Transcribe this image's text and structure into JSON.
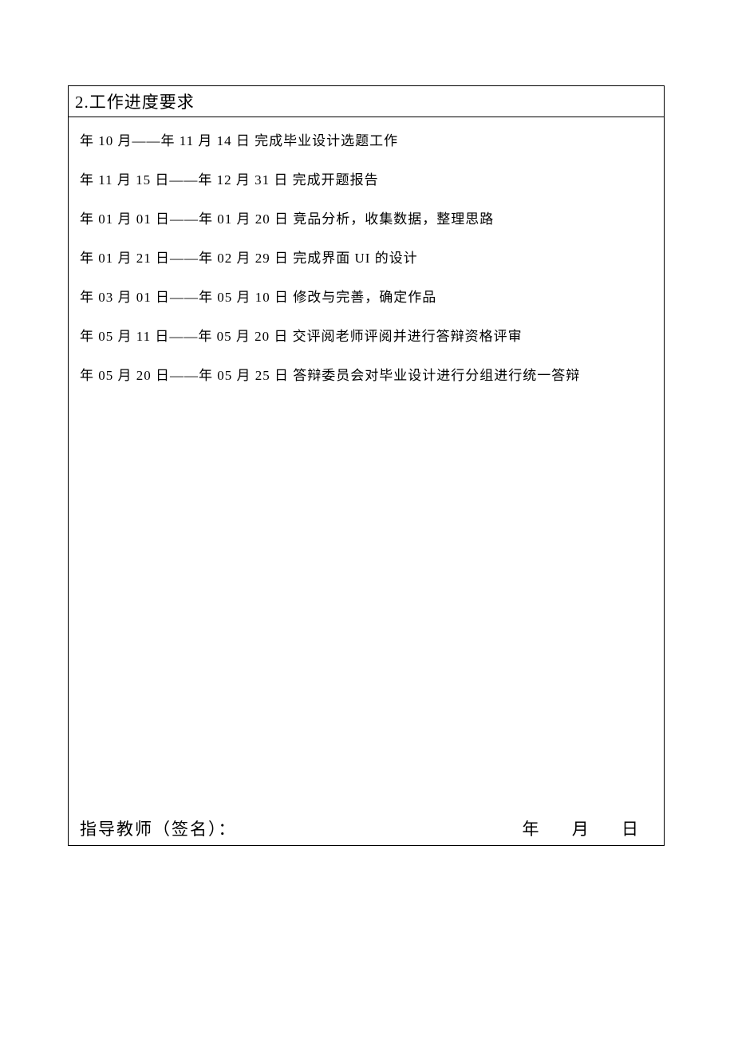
{
  "section": {
    "heading": "2.工作进度要求"
  },
  "schedule": [
    "年 10 月——年 11 月 14 日   完成毕业设计选题工作",
    "年 11 月 15 日——年 12 月 31 日  完成开题报告",
    "年 01 月 01 日——年 01 月 20 日  竞品分析，收集数据，整理思路",
    "年 01 月 21 日——年 02 月 29 日  完成界面 UI 的设计",
    "年 03 月 01 日——年 05 月 10 日  修改与完善，确定作品",
    "年 05 月 11 日——年 05 月 20 日  交评阅老师评阅并进行答辩资格评审",
    "年 05 月 20 日——年 05 月 25 日  答辩委员会对毕业设计进行分组进行统一答辩"
  ],
  "signature": {
    "label": "指导教师（签名）：",
    "year_label": "年",
    "month_label": "月",
    "day_label": "日"
  }
}
